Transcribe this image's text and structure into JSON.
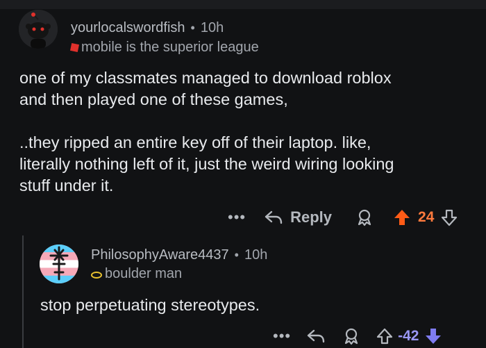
{
  "comments": [
    {
      "author": "yourlocalswordfish",
      "separator": "•",
      "time": "10h",
      "flair": "mobile is the superior league",
      "body_lines": [
        "one of my classmates managed to download roblox",
        "and then played one of these games,",
        "",
        "..they ripped an entire key off of their laptop. like,",
        "literally nothing left of it, just the weird wiring looking",
        "stuff under it."
      ],
      "actions": {
        "more": "•••",
        "reply": "Reply",
        "score": "24"
      },
      "colors": {
        "upvote": "#ff5b16",
        "score": "#ff7a3d",
        "flair_icon": "#e0312c"
      }
    },
    {
      "author": "PhilosophyAware4437",
      "separator": "•",
      "time": "10h",
      "flair": "boulder man",
      "body": "stop perpetuating stereotypes.",
      "actions": {
        "more": "•••",
        "score": "-42"
      },
      "colors": {
        "downvote": "#7f7cf2",
        "score": "#9a97f5",
        "flair_icon": "#e9c22f"
      }
    }
  ],
  "icons": [
    "reddit-avatar-icon",
    "reply-arrow-icon",
    "award-icon",
    "upvote-arrow-icon",
    "downvote-arrow-icon",
    "trans-flag-avatar-icon"
  ]
}
